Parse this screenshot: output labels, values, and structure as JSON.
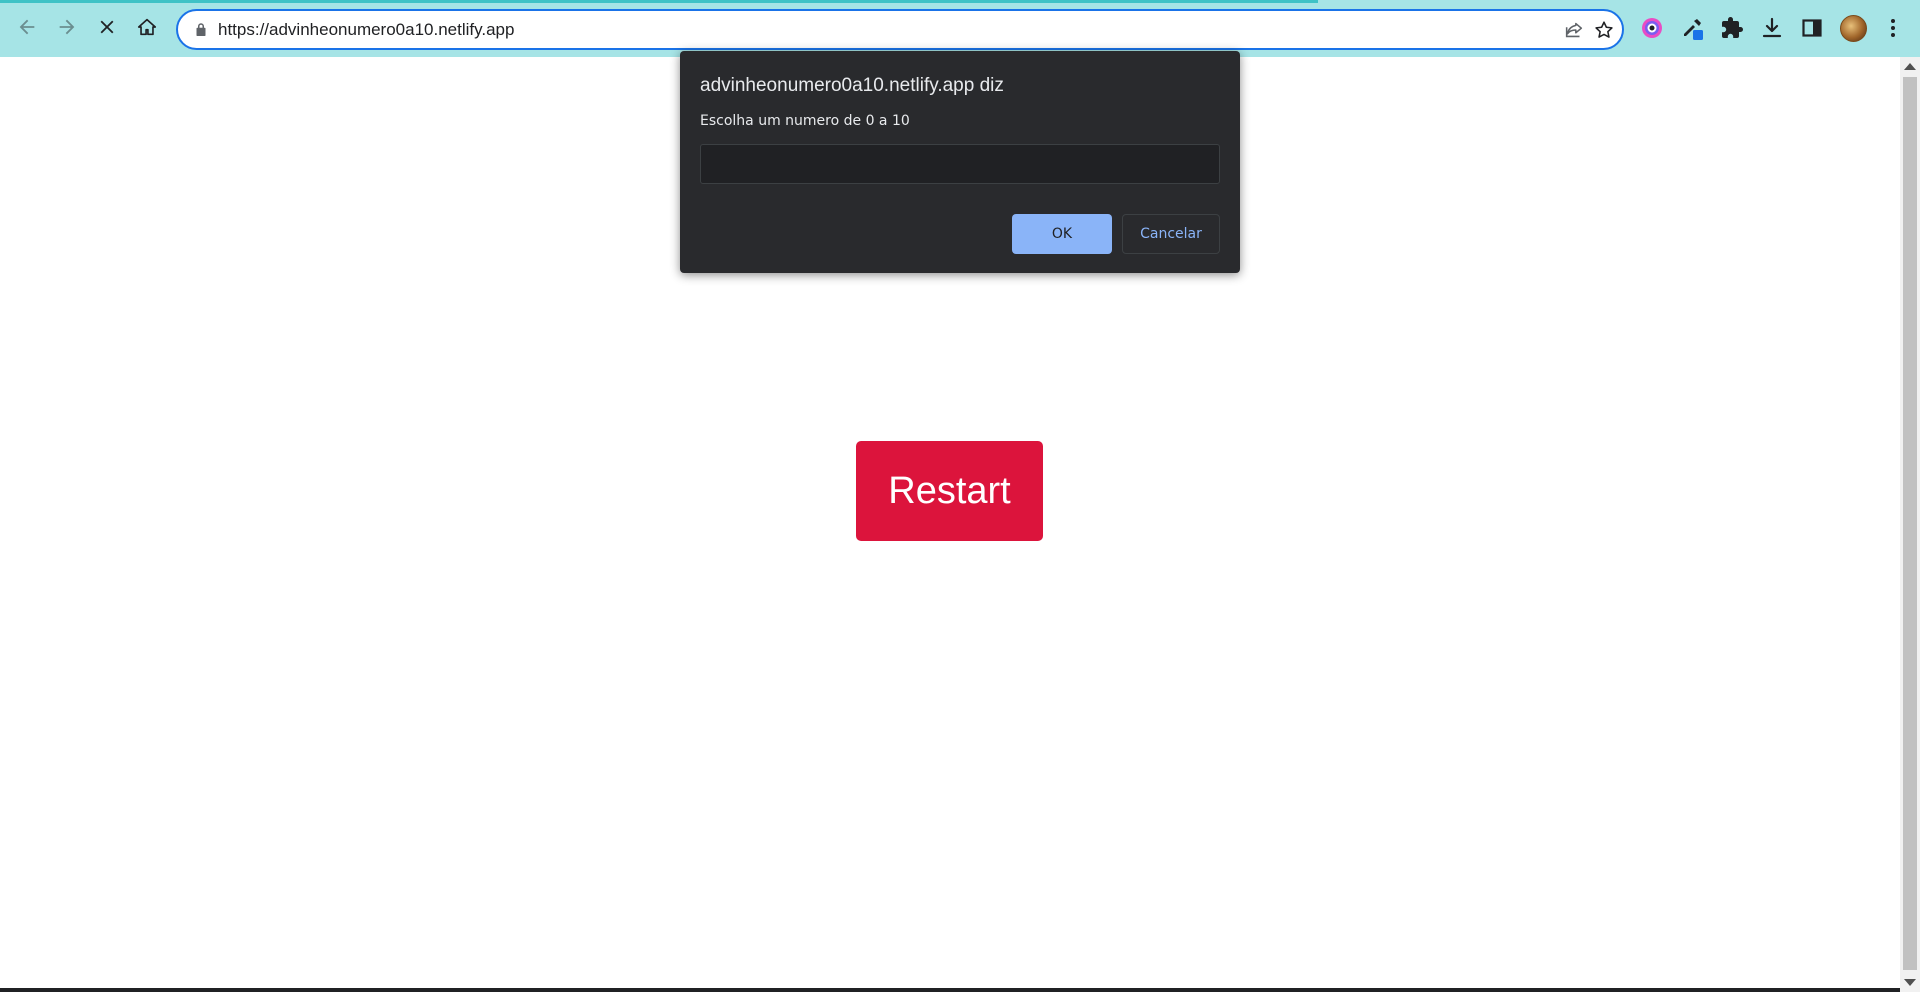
{
  "browser": {
    "url": "https://advinheonumero0a10.netlify.app",
    "nav": {
      "back_icon": "arrow-left-icon",
      "forward_icon": "arrow-right-icon",
      "stop_icon": "close-icon",
      "home_icon": "home-icon"
    },
    "omnibox_icons": [
      "lock-icon",
      "share-icon",
      "star-icon"
    ],
    "extensions": [
      "colorful-circle-extension-icon",
      "eyedropper-extension-icon",
      "puzzle-icon",
      "download-icon",
      "side-panel-icon",
      "avatar",
      "kebab-menu-icon"
    ],
    "accent_color": "#1a73e8",
    "toolbar_color": "#a6e4e6"
  },
  "page": {
    "restart_label": "Restart",
    "restart_color": "#dc143c"
  },
  "dialog": {
    "title": "advinheonumero0a10.netlify.app diz",
    "message": "Escolha um numero de 0 a 10",
    "input_value": "",
    "ok_label": "OK",
    "cancel_label": "Cancelar"
  }
}
